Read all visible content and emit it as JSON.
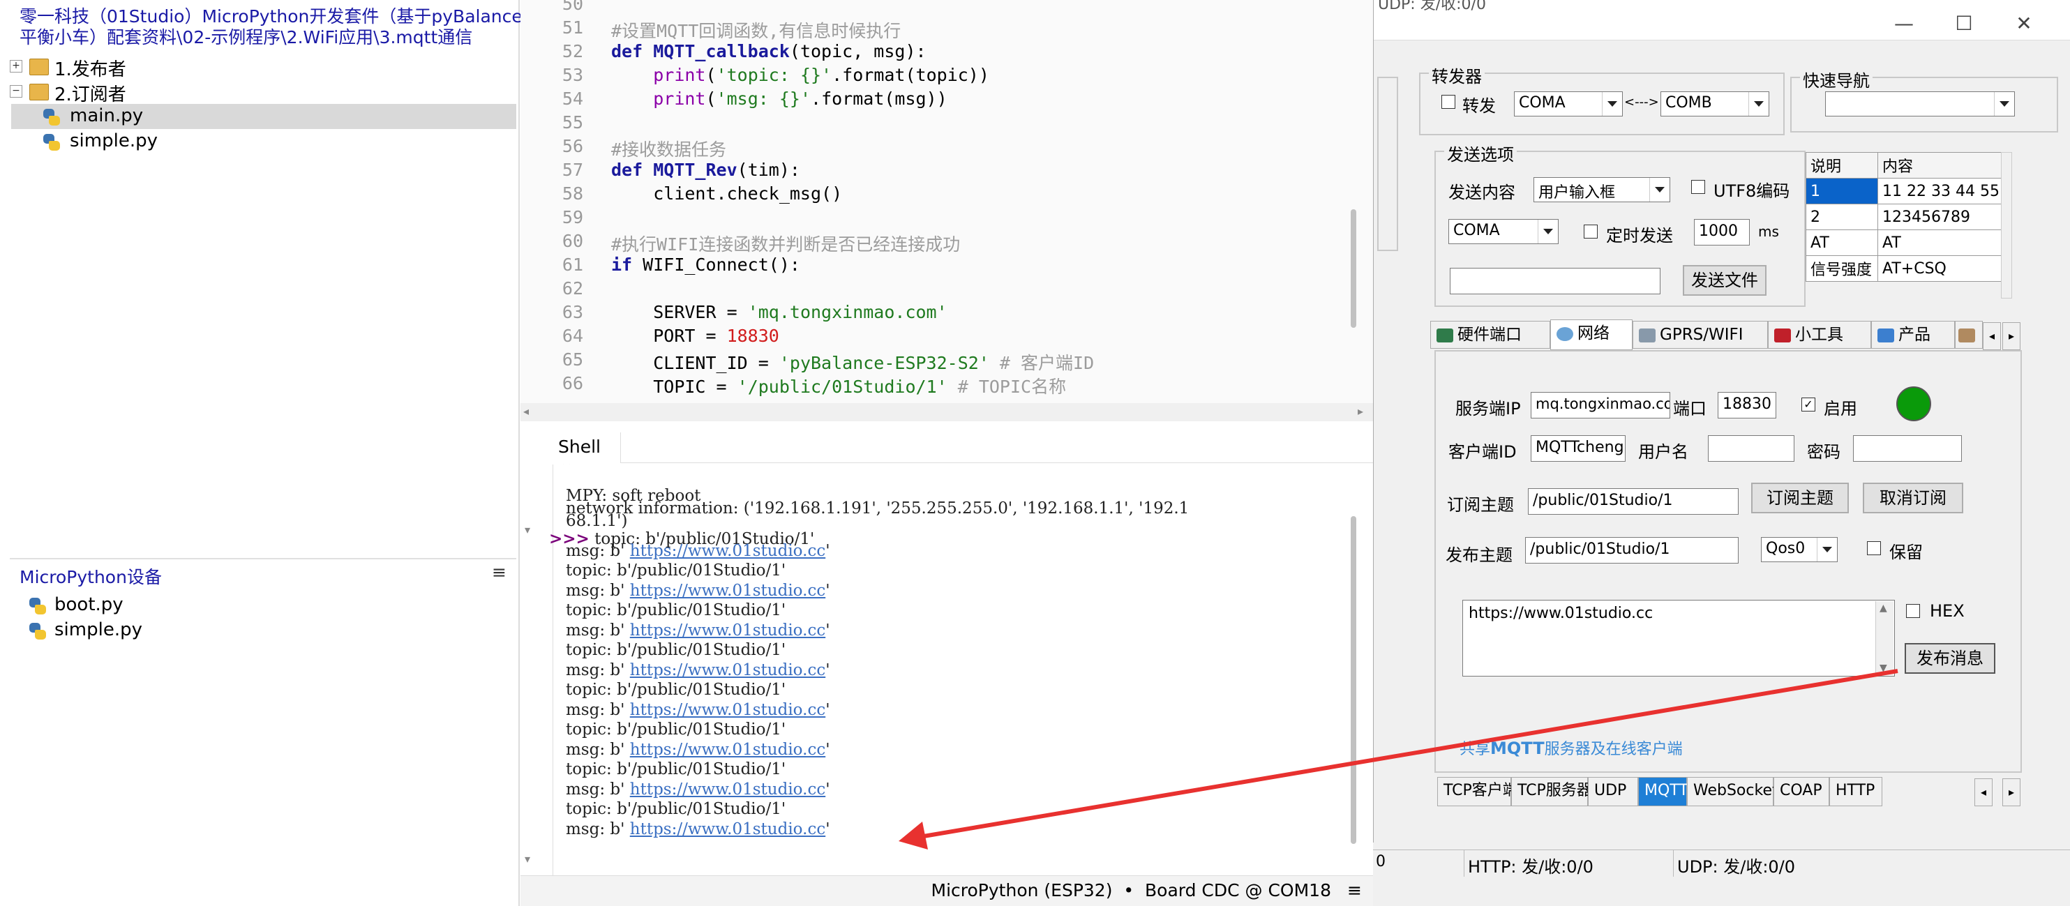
{
  "thonny": {
    "path_line1": "零一科技（01Studio）MicroPython开发套件（基于pyBalance",
    "path_line2": "平衡小车）配套资料\\02-示例程序\\2.WiFi应用\\3.mqtt通信",
    "tree": [
      {
        "label": "1.发布者",
        "expander": "+"
      },
      {
        "label": "2.订阅者",
        "expander": "−"
      },
      {
        "label": "main.py"
      },
      {
        "label": "simple.py"
      }
    ],
    "device_header": "MicroPython设备",
    "device_menu": "≡",
    "device_files": [
      "boot.py",
      "simple.py"
    ]
  },
  "editor": {
    "line_numbers": [
      "50",
      "51",
      "52",
      "53",
      "54",
      "55",
      "56",
      "57",
      "58",
      "59",
      "60",
      "61",
      "62",
      "63",
      "64",
      "65",
      "66"
    ],
    "line51": "#设置MQTT回调函数,有信息时候执行",
    "line52_kw": "def",
    "line52_fn": "MQTT_callback",
    "line52_rest": "(topic, msg):",
    "line53_bi": "print",
    "line53_str": "'topic: {}'",
    "line53_rest": ".format(topic))",
    "line54_bi": "print",
    "line54_str": "'msg: {}'",
    "line54_rest": ".format(msg))",
    "line56": "#接收数据任务",
    "line57_kw": "def",
    "line57_fn": "MQTT_Rev",
    "line57_rest": "(tim):",
    "line58": "client.check_msg()",
    "line60": "#执行WIFI连接函数并判断是否已经连接成功",
    "line61_kw": "if",
    "line61_rest": " WIFI_Connect():",
    "line63_var": "SERVER = ",
    "line63_str": "'mq.tongxinmao.com'",
    "line64_var": "PORT = ",
    "line64_num": "18830",
    "line65_var": "CLIENT_ID = ",
    "line65_str": "'pyBalance-ESP32-S2'",
    "line65_cm": " # 客户端ID",
    "line66_var": "TOPIC = ",
    "line66_str": "'/public/01Studio/1'",
    "line66_cm": " # TOPIC名称"
  },
  "shell": {
    "tab_label": "Shell",
    "tab_close": "×",
    "line1": "MPY: soft reboot",
    "line2": "network information: ('192.168.1.191', '255.255.255.0', '192.168.1.1', '192.1",
    "line3": "68.1.1')",
    "prompt": ">>>",
    "first_topic": " topic: b'/public/01Studio/1'",
    "topic": "topic: b'/public/01Studio/1'",
    "msg_prefix": "msg: b' ",
    "msg_link": "https://www.01studio.cc",
    "msg_suffix": "'"
  },
  "statusbar": {
    "text": "MicroPython (ESP32)  •  Board CDC @ COM18",
    "menu": "≡"
  },
  "tool": {
    "top_partial": "UDP: 发/收:0/0",
    "window_buttons": {
      "min": "—",
      "max": "☐",
      "close": "✕"
    },
    "forwarder_title": "转发器",
    "forward_label": "转发",
    "forward_from": "COMA",
    "forward_arrow": "<--->",
    "forward_to": "COMB",
    "quicknav_title": "快速导航",
    "send_options_title": "发送选项",
    "send_content_label": "发送内容",
    "send_content_value": "用户输入框",
    "utf8_label": "UTF8编码",
    "port_value": "COMA",
    "timed_label": "定时发送",
    "timed_interval": "1000",
    "ms_label": "ms",
    "send_file_button": "发送文件",
    "table": {
      "headers": [
        "说明",
        "内容"
      ],
      "rows": [
        [
          "1",
          "11 22 33 44 55"
        ],
        [
          "2",
          "123456789"
        ],
        [
          "AT",
          "AT"
        ],
        [
          "信号强度",
          "AT+CSQ"
        ]
      ]
    },
    "main_tabs": [
      "硬件端口",
      "网络",
      "GPRS/WIFI",
      "小工具",
      "产品"
    ],
    "server_ip_label": "服务端IP",
    "server_ip": "mq.tongxinmao.com",
    "port_label": "端口",
    "port": "18830",
    "enable_label": "启用",
    "status_color": "#0a9a0a",
    "client_id_label": "客户端ID",
    "client_id": "MQTTcheng",
    "username_label": "用户名",
    "password_label": "密码",
    "subscribe_topic_label": "订阅主题",
    "subscribe_topic": "/public/01Studio/1",
    "subscribe_button": "订阅主题",
    "unsubscribe_button": "取消订阅",
    "publish_topic_label": "发布主题",
    "publish_topic": "/public/01Studio/1",
    "qos": "Qos0",
    "retain_label": "保留",
    "message_text": "https://www.01studio.cc",
    "hex_label": "HEX",
    "publish_button": "发布消息",
    "shared_link_prefix": "共享",
    "shared_link_bold": "MQTT",
    "shared_link_suffix": "服务器及在线客户端",
    "bottom_tabs": [
      "TCP客户端",
      "TCP服务器",
      "UDP",
      "MQTT",
      "WebSockets",
      "COAP",
      "HTTP"
    ],
    "status_http": "HTTP: 发/收:0/0",
    "status_udp": "UDP: 发/收:0/0",
    "status_left": "0"
  },
  "colors": {
    "arrow": "#e8312f",
    "tab_active": "#1e7fd6"
  }
}
